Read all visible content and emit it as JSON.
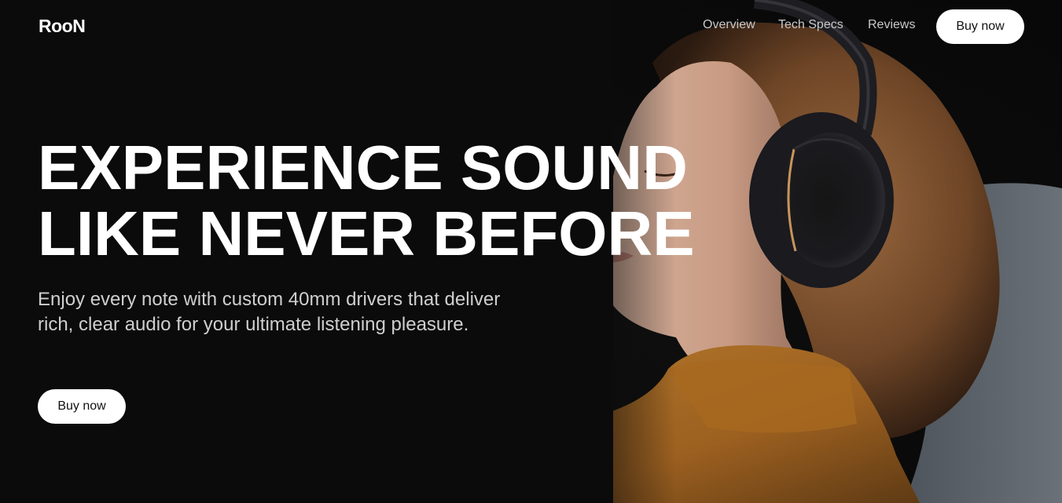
{
  "brand": {
    "logo_text": "RooN"
  },
  "nav": {
    "links": [
      {
        "label": "Overview"
      },
      {
        "label": "Tech Specs"
      },
      {
        "label": "Reviews"
      }
    ],
    "cta_label": "Buy now"
  },
  "hero": {
    "headline_line1": "EXPERIENCE SOUND",
    "headline_line2": "LIKE NEVER BEFORE",
    "description": "Enjoy every note with custom 40mm drivers that deliver rich, clear audio for your ultimate listening pleasure.",
    "cta_label": "Buy now",
    "image_subject": "woman-wearing-headphones",
    "colors": {
      "background": "#0d0d0d",
      "button": "#ffffff",
      "sweater": "#a86a24",
      "hair": "#8a5a33"
    }
  }
}
